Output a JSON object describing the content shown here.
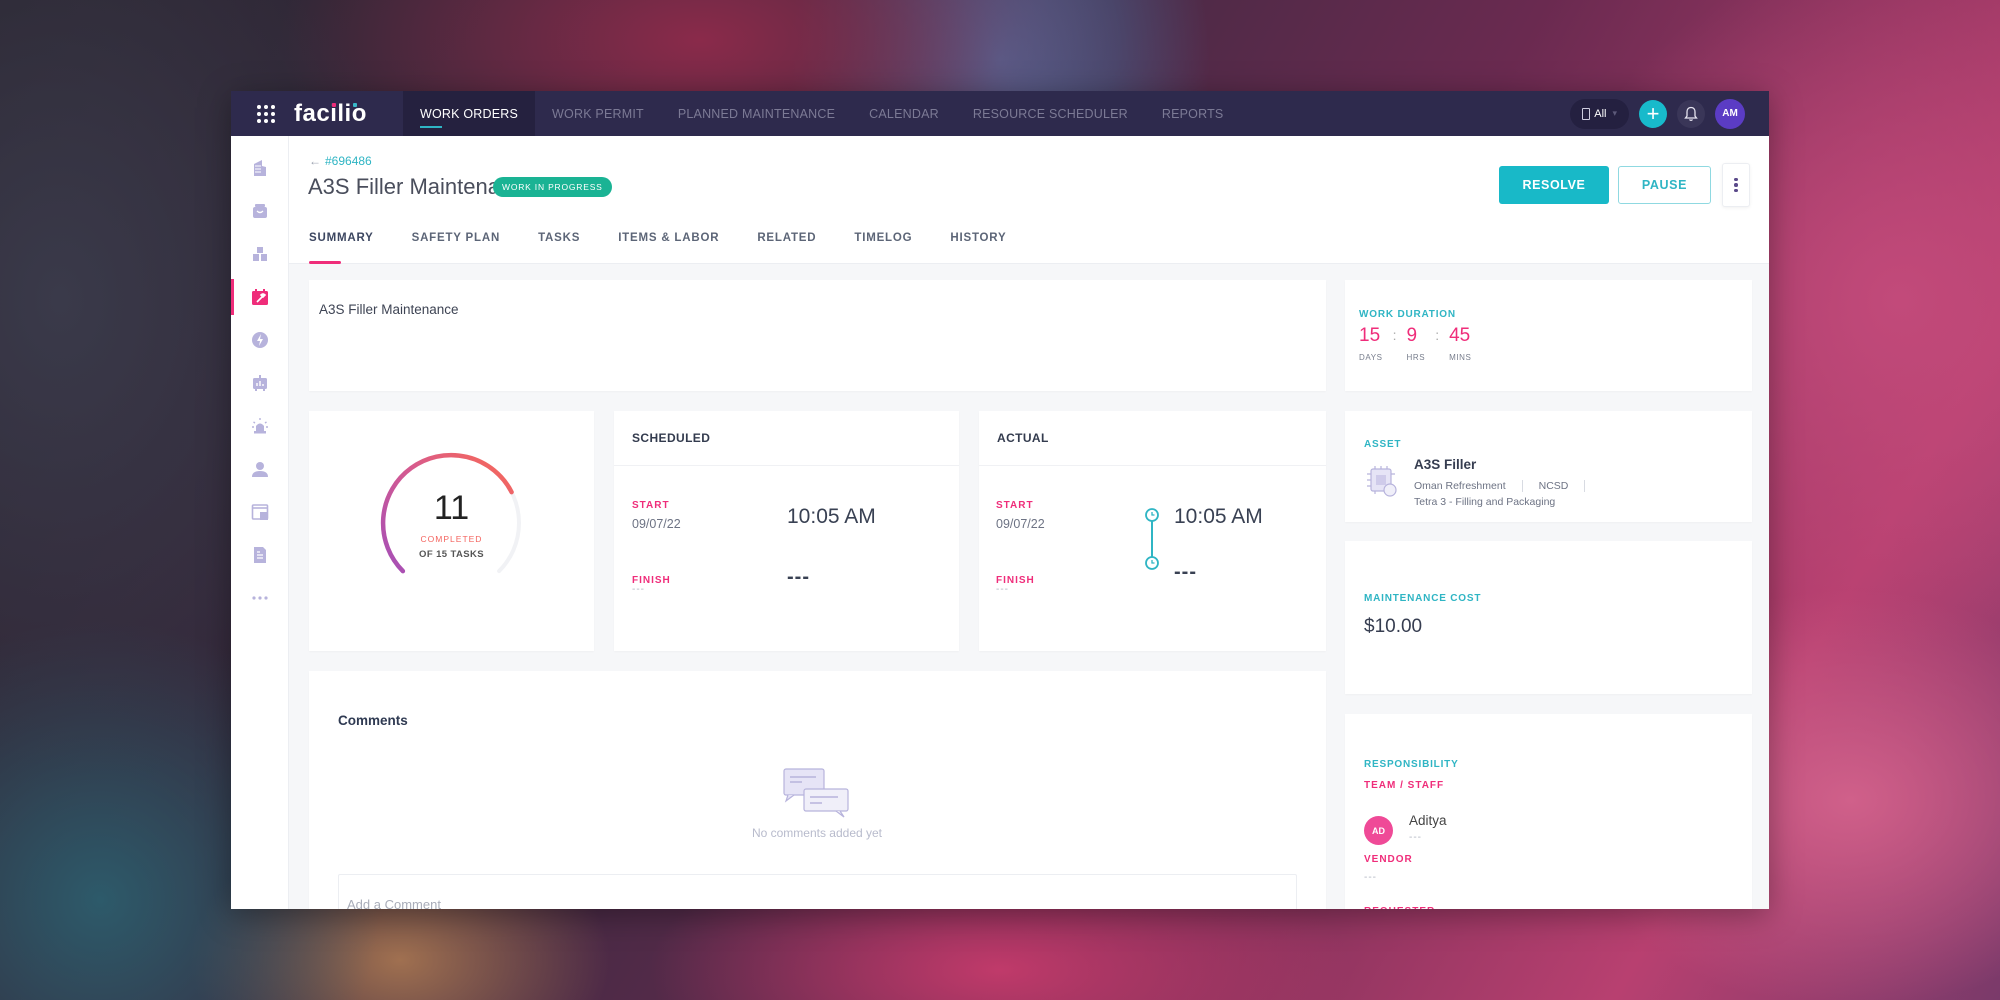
{
  "topbar": {
    "logo": "facilio",
    "nav": [
      {
        "label": "WORK ORDERS",
        "active": true
      },
      {
        "label": "WORK PERMIT",
        "active": false
      },
      {
        "label": "PLANNED MAINTENANCE",
        "active": false
      },
      {
        "label": "CALENDAR",
        "active": false
      },
      {
        "label": "RESOURCE SCHEDULER",
        "active": false
      },
      {
        "label": "REPORTS",
        "active": false
      }
    ],
    "site_selector": "All",
    "user_initials": "AM"
  },
  "sidebar": {
    "items": [
      {
        "icon": "building-icon"
      },
      {
        "icon": "inbox-icon"
      },
      {
        "icon": "boxes-icon"
      },
      {
        "icon": "work-order-calendar-icon",
        "active": true
      },
      {
        "icon": "energy-icon"
      },
      {
        "icon": "analytics-icon"
      },
      {
        "icon": "alarm-icon"
      },
      {
        "icon": "people-icon"
      },
      {
        "icon": "portal-icon"
      },
      {
        "icon": "invoice-icon"
      },
      {
        "icon": "more-icon"
      }
    ]
  },
  "header": {
    "back_id": "#696486",
    "title": "A3S Filler Maintenance",
    "status": "WORK IN PROGRESS",
    "resolve_label": "RESOLVE",
    "pause_label": "PAUSE",
    "tabs": [
      {
        "label": "SUMMARY",
        "active": true
      },
      {
        "label": "SAFETY PLAN"
      },
      {
        "label": "TASKS"
      },
      {
        "label": "ITEMS & LABOR"
      },
      {
        "label": "RELATED"
      },
      {
        "label": "TIMELOG"
      },
      {
        "label": "HISTORY"
      }
    ]
  },
  "description": "A3S Filler Maintenance",
  "tasks": {
    "completed": "11",
    "completed_label": "COMPLETED",
    "total_label": "OF 15 TASKS",
    "completed_count": 11,
    "total_count": 15
  },
  "scheduled": {
    "title": "SCHEDULED",
    "start_label": "START",
    "start_date": "09/07/22",
    "start_time": "10:05 AM",
    "finish_label": "FINISH",
    "finish_date": "---",
    "finish_time": "---"
  },
  "actual": {
    "title": "ACTUAL",
    "start_label": "START",
    "start_date": "09/07/22",
    "start_time": "10:05 AM",
    "finish_label": "FINISH",
    "finish_date": "---",
    "finish_time": "---"
  },
  "comments": {
    "title": "Comments",
    "empty_text": "No comments added yet",
    "input_placeholder": "Add a Comment"
  },
  "work_duration": {
    "label": "WORK DURATION",
    "days": "15",
    "hours": "9",
    "mins": "45",
    "sep": ":",
    "days_label": "DAYS",
    "hours_label": "HRS",
    "mins_label": "MINS"
  },
  "asset": {
    "label": "ASSET",
    "name": "A3S Filler",
    "site": "Oman Refreshment",
    "building": "NCSD",
    "space": "Tetra 3 - Filling and Packaging"
  },
  "maintenance_cost": {
    "label": "MAINTENANCE COST",
    "value": "$10.00"
  },
  "responsibility": {
    "label": "RESPONSIBILITY",
    "team_label": "TEAM / STAFF",
    "staff_initials": "AD",
    "staff_name": "Aditya",
    "staff_sub": "---",
    "vendor_label": "VENDOR",
    "vendor_value": "---",
    "requester_label": "REQUESTER"
  },
  "colors": {
    "accent_teal": "#18b9c8",
    "accent_pink": "#ef2d7a",
    "status_green": "#1ab394",
    "topbar": "#2e2a4d"
  }
}
